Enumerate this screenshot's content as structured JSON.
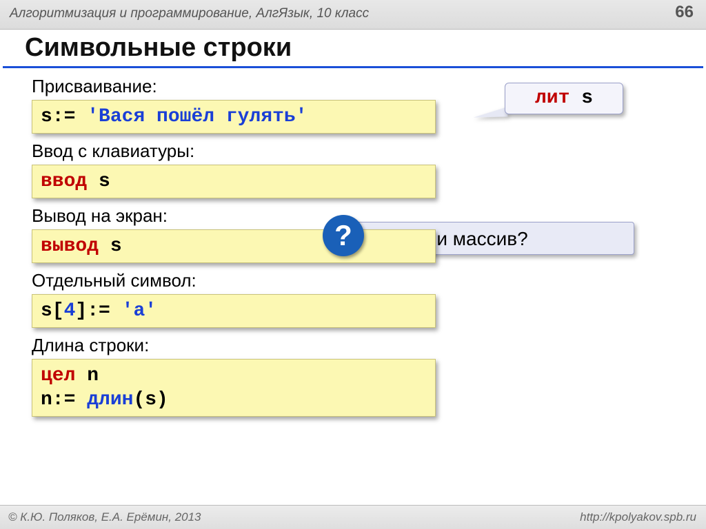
{
  "header": {
    "breadcrumb": "Алгоритмизация и программирование, АлгЯзык, 10 класс",
    "page": "66"
  },
  "title": "Символьные строки",
  "callout": {
    "kw": "лит",
    "var": " s"
  },
  "question": {
    "mark": "?",
    "text": "А если массив?"
  },
  "sections": {
    "assign": {
      "label": "Присваивание:",
      "code_pre": "s:= ",
      "code_lit": "'Вася пошёл гулять'"
    },
    "input": {
      "label": "Ввод с клавиатуры:",
      "code_kw": "ввод",
      "code_rest": " s"
    },
    "output": {
      "label": "Вывод на экран:",
      "code_kw": "вывод",
      "code_rest": " s"
    },
    "char": {
      "label": "Отдельный символ:",
      "p1": "s[",
      "idx": "4",
      "p2": "]:= ",
      "lit": "'a'"
    },
    "len": {
      "label": "Длина строки:",
      "kw1": "цел",
      "r1": " n",
      "l2a": "n:= ",
      "kw2": "длин",
      "l2b": "(s)"
    }
  },
  "footer": {
    "left": "© К.Ю. Поляков, Е.А. Ерёмин, 2013",
    "right": "http://kpolyakov.spb.ru"
  }
}
